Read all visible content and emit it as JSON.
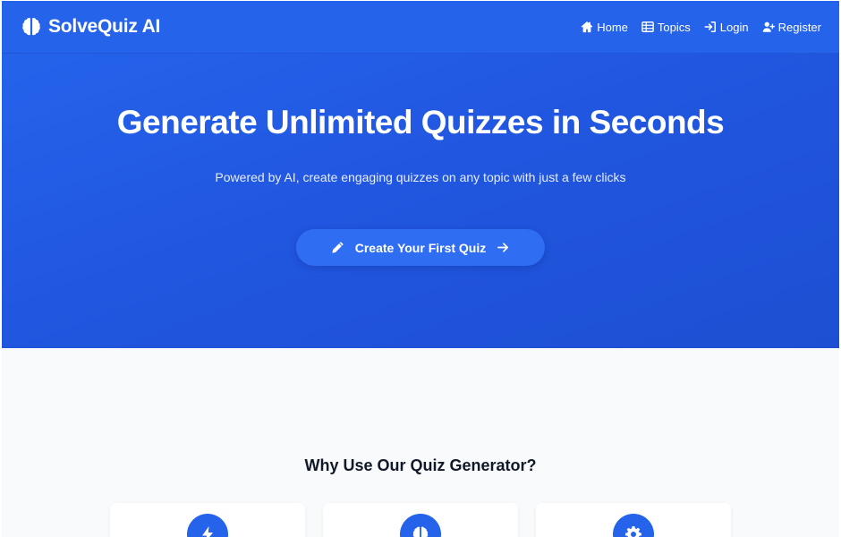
{
  "brand": {
    "name": "SolveQuiz AI",
    "icon": "brain-icon"
  },
  "nav": {
    "items": [
      {
        "label": "Home",
        "icon": "home-icon"
      },
      {
        "label": "Topics",
        "icon": "table-icon"
      },
      {
        "label": "Login",
        "icon": "login-icon"
      },
      {
        "label": "Register",
        "icon": "user-plus-icon"
      }
    ]
  },
  "hero": {
    "title": "Generate Unlimited Quizzes in Seconds",
    "subtitle": "Powered by AI, create engaging quizzes on any topic with just a few clicks",
    "cta_label": "Create Your First Quiz",
    "cta_icons": [
      "pencil-icon",
      "arrow-right-icon"
    ]
  },
  "features": {
    "title": "Why Use Our Quiz Generator?",
    "cards": [
      {
        "icon": "bolt-icon"
      },
      {
        "icon": "brain-icon"
      },
      {
        "icon": "gear-icon"
      }
    ]
  },
  "colors": {
    "primary": "#2563eb",
    "hero_gradient_end": "#1d4fd2",
    "cta": "#2f6df2",
    "section_bg": "#f8fafc",
    "text_dark": "#111827"
  }
}
